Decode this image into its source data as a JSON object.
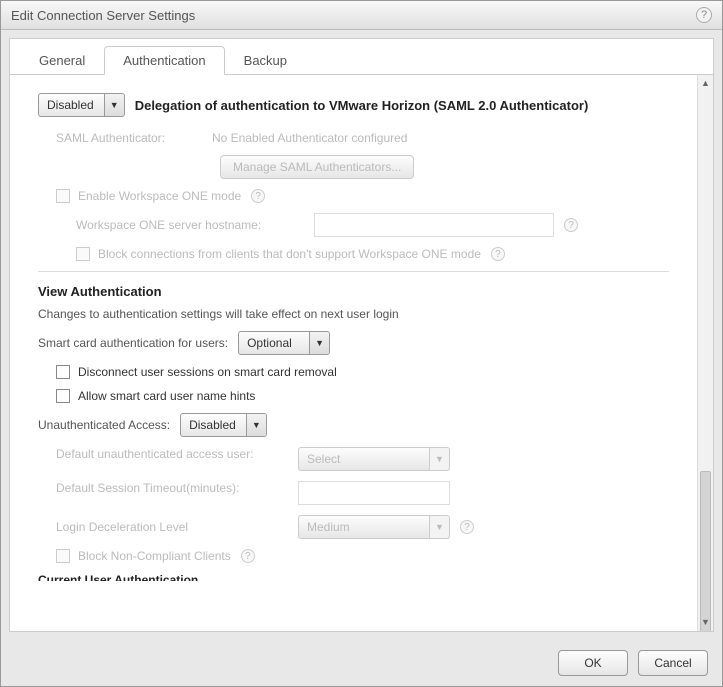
{
  "dialog": {
    "title": "Edit Connection Server Settings"
  },
  "tabs": {
    "general": "General",
    "authentication": "Authentication",
    "backup": "Backup"
  },
  "delegation": {
    "dropdown_value": "Disabled",
    "label": "Delegation of authentication to VMware Horizon (SAML 2.0 Authenticator)",
    "saml_auth_label": "SAML Authenticator:",
    "saml_auth_value": "No Enabled Authenticator configured",
    "manage_btn": "Manage SAML Authenticators...",
    "enable_ws1": "Enable Workspace ONE mode",
    "ws1_host_label": "Workspace ONE server hostname:",
    "ws1_host_value": "",
    "block_clients": "Block connections from clients that don't support Workspace ONE mode"
  },
  "view_auth": {
    "header": "View Authentication",
    "note": "Changes to authentication settings will take effect on next user login",
    "smartcard_label": "Smart card authentication for users:",
    "smartcard_value": "Optional",
    "disconnect_on_removal": "Disconnect user sessions on smart card removal",
    "allow_hints": "Allow smart card user name hints",
    "unauth_label": "Unauthenticated Access:",
    "unauth_value": "Disabled",
    "default_user_label": "Default unauthenticated access user:",
    "default_user_value": "Select",
    "session_timeout_label": "Default Session Timeout(minutes):",
    "session_timeout_value": "",
    "decel_label": "Login Deceleration Level",
    "decel_value": "Medium",
    "block_noncompliant": "Block Non-Compliant Clients",
    "cutoff_header": "Current User Authentication"
  },
  "footer": {
    "ok": "OK",
    "cancel": "Cancel"
  }
}
